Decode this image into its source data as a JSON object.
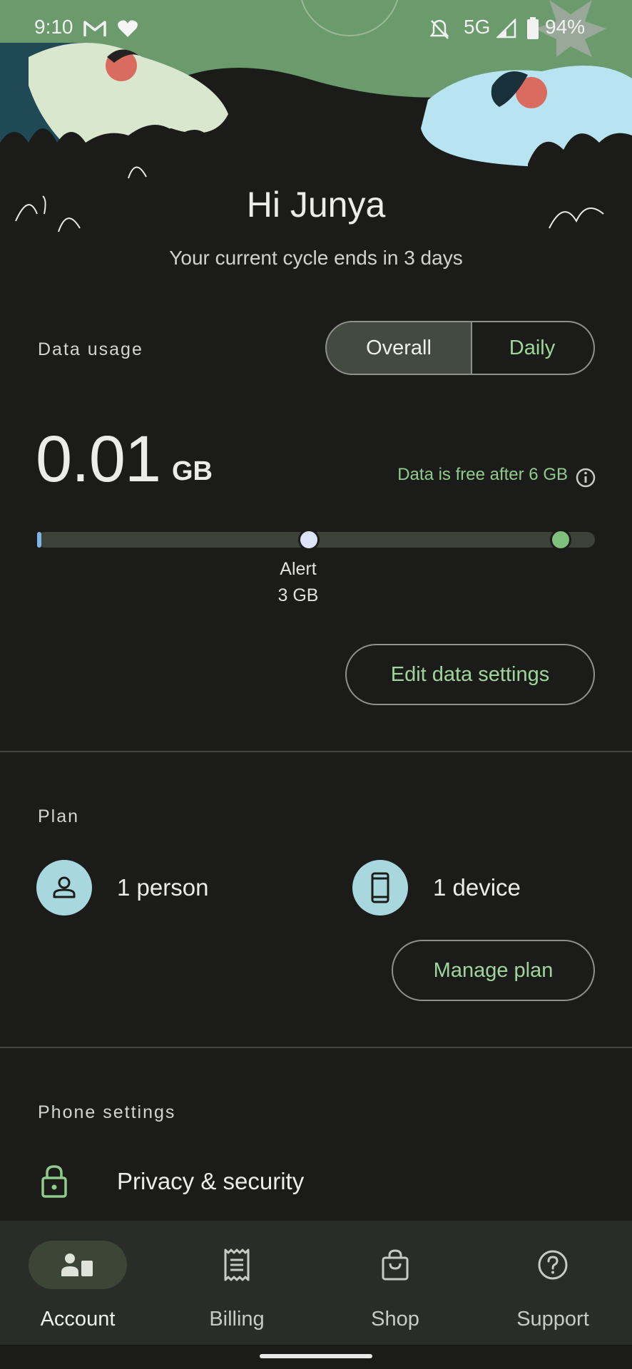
{
  "status_bar": {
    "time": "9:10",
    "network": "5G",
    "battery": "94%",
    "icons": [
      "gmail-icon",
      "heart-icon",
      "mute-icon",
      "signal-icon",
      "battery-icon"
    ]
  },
  "greeting": {
    "title": "Hi Junya",
    "subtitle": "Your current cycle ends in 3 days"
  },
  "data_usage": {
    "label": "Data usage",
    "toggle": {
      "options": [
        "Overall",
        "Daily"
      ],
      "selected": "Overall"
    },
    "amount": "0.01",
    "unit": "GB",
    "free_note": "Data is free after 6 GB",
    "alert_label": "Alert",
    "alert_value": "3 GB",
    "usage_fraction": 0.0017,
    "alert_fraction": 0.5,
    "edit_button": "Edit data settings"
  },
  "plan": {
    "label": "Plan",
    "people": "1 person",
    "devices": "1 device",
    "manage_button": "Manage plan"
  },
  "phone_settings": {
    "label": "Phone settings",
    "privacy": "Privacy & security"
  },
  "bottom_nav": {
    "items": [
      {
        "label": "Account",
        "icon": "account-icon",
        "active": true
      },
      {
        "label": "Billing",
        "icon": "receipt-icon",
        "active": false
      },
      {
        "label": "Shop",
        "icon": "shopping-bag-icon",
        "active": false
      },
      {
        "label": "Support",
        "icon": "help-icon",
        "active": false
      }
    ]
  },
  "colors": {
    "background": "#1b1c1a",
    "accent_green": "#9ed69a",
    "plan_icon_bg": "#a8d7de",
    "nav_bg": "#2a2c28"
  }
}
